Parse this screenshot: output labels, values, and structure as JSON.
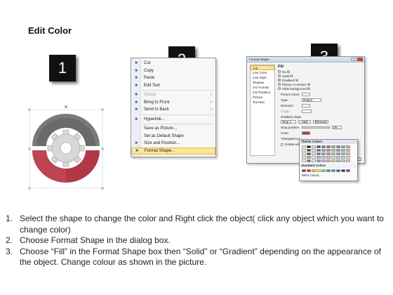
{
  "page": {
    "title": "Edit Color"
  },
  "badges": [
    "1",
    "2",
    "3"
  ],
  "gear_colors": {
    "top": "#6a6a6a",
    "bottom": "#b23848",
    "gear": "#d8d8d8"
  },
  "context_menu": {
    "items": [
      {
        "label": "Cut",
        "icon": "scissors-icon",
        "disabled": false
      },
      {
        "label": "Copy",
        "icon": "copy-icon",
        "disabled": false
      },
      {
        "label": "Paste",
        "icon": "paste-icon",
        "disabled": false
      },
      {
        "label": "Edit Text",
        "icon": "edit-text-icon",
        "disabled": false
      },
      {
        "label": "Group",
        "icon": "group-icon",
        "disabled": true,
        "submenu": true
      },
      {
        "label": "Bring to Front",
        "icon": "bring-front-icon",
        "disabled": false,
        "submenu": true
      },
      {
        "label": "Send to Back",
        "icon": "send-back-icon",
        "disabled": false,
        "submenu": true
      },
      {
        "label": "Hyperlink...",
        "icon": "hyperlink-icon",
        "disabled": false
      },
      {
        "label": "Save as Picture...",
        "icon": "",
        "disabled": false
      },
      {
        "label": "Set as Default Shape",
        "icon": "",
        "disabled": false
      },
      {
        "label": "Size and Position...",
        "icon": "size-icon",
        "disabled": false
      },
      {
        "label": "Format Shape...",
        "icon": "format-icon",
        "disabled": false,
        "highlighted": true
      }
    ]
  },
  "format_dialog": {
    "title": "Format Shape",
    "categories": [
      "Fill",
      "Line Color",
      "Line Style",
      "Shadow",
      "3-D Format",
      "3-D Rotation",
      "Picture",
      "Text Box"
    ],
    "selected_category": "Fill",
    "pane_title": "Fill",
    "options": [
      {
        "label": "No fill",
        "checked": false
      },
      {
        "label": "Solid fill",
        "checked": false
      },
      {
        "label": "Gradient fill",
        "checked": true
      },
      {
        "label": "Picture or texture fill",
        "checked": false
      },
      {
        "label": "Slide background fill",
        "checked": false
      }
    ],
    "preset_label": "Preset colors:",
    "type_label": "Type:",
    "type_value": "Radial",
    "direction_label": "Direction:",
    "angle_label": "Angle:",
    "gradient_stops_label": "Gradient stops",
    "stop_value": "Stop 1",
    "add_label": "Add",
    "remove_label": "Remove",
    "stop_position_label": "Stop position:",
    "stop_position_value": "0%",
    "color_label": "Color:",
    "transparency_label": "Transparency:",
    "rotate_label": "Rotate with shape"
  },
  "palette": {
    "header": "Theme Colors",
    "standard_label": "Standard Colors",
    "more_label": "More Colors...",
    "theme_top": [
      "#ffffff",
      "#000000",
      "#eeece1",
      "#1f497d",
      "#4f81bd",
      "#c0504d",
      "#9bbb59",
      "#8064a2",
      "#4bacc6",
      "#f79646"
    ],
    "standard": [
      "#c00000",
      "#ff0000",
      "#ffc000",
      "#ffff00",
      "#92d050",
      "#00b050",
      "#00b0f0",
      "#0070c0",
      "#002060",
      "#7030a0"
    ]
  },
  "steps": [
    {
      "num": "1.",
      "text": "Select the shape to change the color and Right click the object( click any object which you want to change color)"
    },
    {
      "num": "2.",
      "text": "Choose Format Shape in the dialog box."
    },
    {
      "num": "3.",
      "text": "Choose “Fill” in the Format Shape box then “Solid” or “Gradient” depending on the appearance of the object. Change colour as shown in the picture."
    }
  ]
}
